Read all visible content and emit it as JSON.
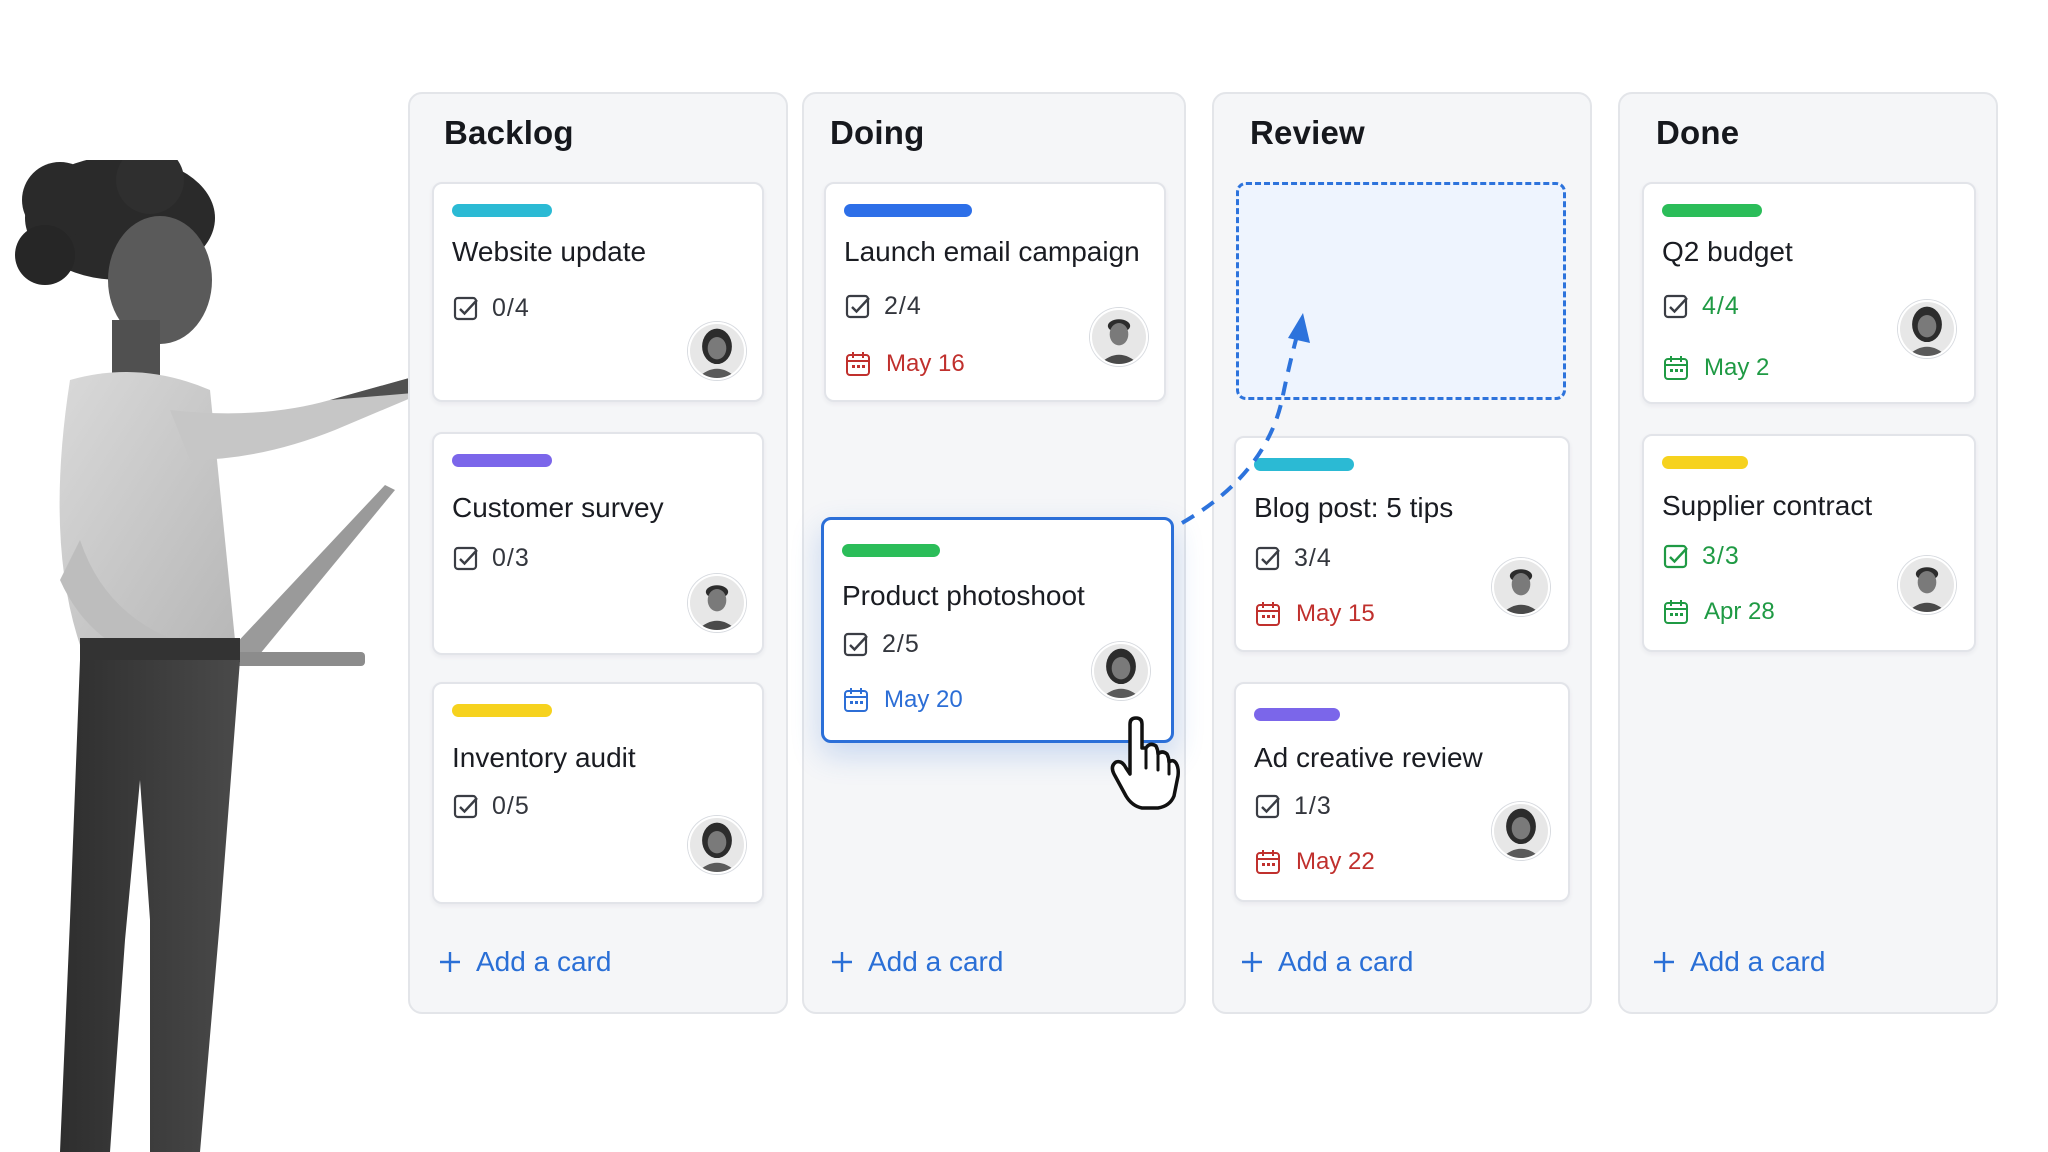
{
  "board": {
    "columns": [
      {
        "title": "Backlog",
        "add_label": "Add a card",
        "cards": [
          {
            "title": "Website update",
            "label_color": "#2bbad4",
            "checklist": "0/4",
            "avatar": "female"
          },
          {
            "title": "Customer survey",
            "label_color": "#7b66ea",
            "checklist": "0/3",
            "avatar": "male"
          },
          {
            "title": "Inventory audit",
            "label_color": "#f6d21e",
            "checklist": "0/5",
            "avatar": "female"
          }
        ]
      },
      {
        "title": "Doing",
        "add_label": "Add a card",
        "cards": [
          {
            "title": "Launch email campaign",
            "label_color": "#2d6fe8",
            "checklist": "2/4",
            "due": "May 16",
            "due_color": "#c0302d",
            "avatar": "male"
          },
          {
            "title": "Product photoshoot",
            "label_color": "#2bbd59",
            "checklist": "2/5",
            "due": "May 20",
            "due_color": "#2c6ed6",
            "avatar": "female",
            "state": "dragging"
          }
        ]
      },
      {
        "title": "Review",
        "add_label": "Add a card",
        "cards": [
          {
            "title": "Blog post: 5 tips",
            "label_color": "#2bbad4",
            "checklist": "3/4",
            "due": "May 15",
            "due_color": "#c0302d",
            "avatar": "male"
          },
          {
            "title": "Ad creative review",
            "label_color": "#7b66ea",
            "checklist": "1/3",
            "due": "May 22",
            "due_color": "#c0302d",
            "avatar": "female"
          }
        ]
      },
      {
        "title": "Done",
        "add_label": "Add a card",
        "cards": [
          {
            "title": "Q2 budget",
            "label_color": "#2bbd59",
            "checklist": "4/4",
            "due": "May 2",
            "due_color": "#1f9a44",
            "checklist_color": "#1f9a44",
            "avatar": "female"
          },
          {
            "title": "Supplier contract",
            "label_color": "#f6d21e",
            "checklist": "3/3",
            "due": "Apr 28",
            "due_color": "#1f9a44",
            "checklist_color": "#1f9a44",
            "avatar": "male"
          }
        ]
      }
    ]
  },
  "colors": {
    "accent": "#2b6fd8",
    "overdue": "#c0302d",
    "complete": "#1f9a44",
    "link": "#2a6fd6"
  },
  "icons": [
    "checklist-icon",
    "calendar-icon",
    "plus-icon",
    "hand-pointer-icon",
    "drag-arrow-icon"
  ]
}
